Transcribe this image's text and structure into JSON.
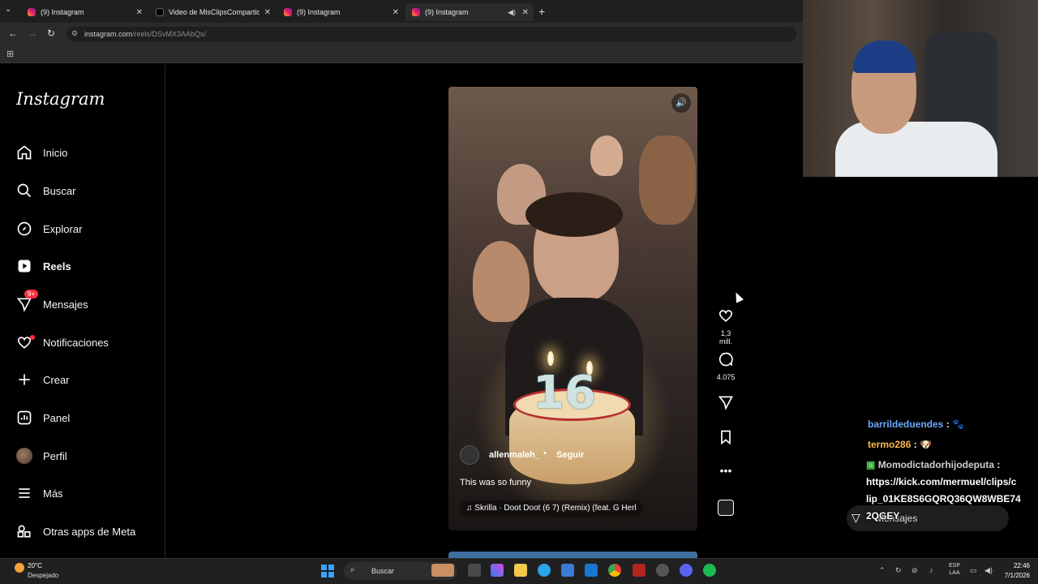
{
  "browser": {
    "tabs": [
      {
        "title": "(9) Instagram",
        "favicon": "instagram-icon",
        "active": false
      },
      {
        "title": "Video de MisClipsCompartidos",
        "favicon": "tiktok-icon",
        "active": false
      },
      {
        "title": "(9) Instagram",
        "favicon": "instagram-icon",
        "active": false
      },
      {
        "title": "(9) Instagram",
        "favicon": "instagram-icon",
        "active": true
      }
    ],
    "url_domain": "instagram.com",
    "url_path": "/reels/DSvMX3AAbQs/"
  },
  "sidebar": {
    "logo": "Instagram",
    "items": [
      {
        "label": "Inicio",
        "icon": "home-icon"
      },
      {
        "label": "Buscar",
        "icon": "search-icon"
      },
      {
        "label": "Explorar",
        "icon": "compass-icon"
      },
      {
        "label": "Reels",
        "icon": "reels-icon"
      },
      {
        "label": "Mensajes",
        "icon": "messenger-icon",
        "badge": "9+"
      },
      {
        "label": "Notificaciones",
        "icon": "heart-icon"
      },
      {
        "label": "Crear",
        "icon": "plus-icon"
      },
      {
        "label": "Panel",
        "icon": "dashboard-icon"
      },
      {
        "label": "Perfil",
        "icon": "avatar"
      },
      {
        "label": "Más",
        "icon": "menu-icon"
      },
      {
        "label": "Otras apps de Meta",
        "icon": "meta-apps-icon"
      }
    ]
  },
  "reel": {
    "username": "allenmaleh_",
    "separator": "•",
    "follow_label": "Seguir",
    "caption": "This was so funny",
    "music": "Skrilla · Doot Doot (6 7) (Remix) (feat. G Herl",
    "candle_text": "16",
    "likes": "1,3 mill.",
    "comments": "4.075"
  },
  "chat": {
    "lines": [
      {
        "user": "barrildeduendes",
        "text": ":"
      },
      {
        "user": "termo286",
        "text": ":"
      },
      {
        "user": "Momodictadorhijodeputa",
        "text": ":"
      },
      {
        "user": "",
        "text": "https://kick.com/mermuel/clips/c"
      },
      {
        "user": "",
        "text": "lip_01KE8S6GQRQ36QW8WBE74"
      },
      {
        "user": "",
        "text": "2QGEY"
      }
    ],
    "messages_pill": "Mensajes"
  },
  "taskbar": {
    "weather_temp": "20°C",
    "weather_desc": "Despejado",
    "search_placeholder": "Buscar",
    "lang_line1": "ESP",
    "lang_line2": "LAA",
    "time": "22:46",
    "date": "7/1/2026"
  },
  "colors": {
    "accent_red": "#ff3040",
    "chat_user_blue": "#6ea8ff",
    "chat_user_orange": "#ffb74d",
    "windows_blue": "#3aa0ff"
  }
}
